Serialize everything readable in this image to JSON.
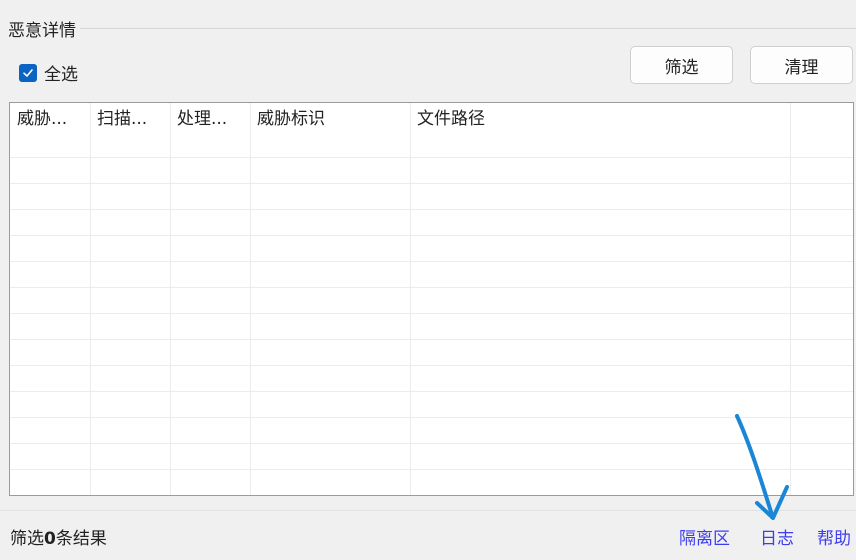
{
  "group": {
    "title": "恶意详情"
  },
  "select_all": {
    "label": "全选",
    "checked": true
  },
  "buttons": {
    "filter": "筛选",
    "clean": "清理"
  },
  "table": {
    "columns": [
      "威胁...",
      "扫描...",
      "处理...",
      "威胁标识",
      "文件路径"
    ],
    "rows": []
  },
  "status": {
    "prefix": "筛选",
    "count": "0",
    "suffix": "条结果"
  },
  "links": {
    "quarantine": "隔离区",
    "log": "日志",
    "help": "帮助"
  },
  "colors": {
    "accent": "#0b63c4",
    "link": "#3d3df0",
    "annotation_arrow": "#1a86d6"
  }
}
